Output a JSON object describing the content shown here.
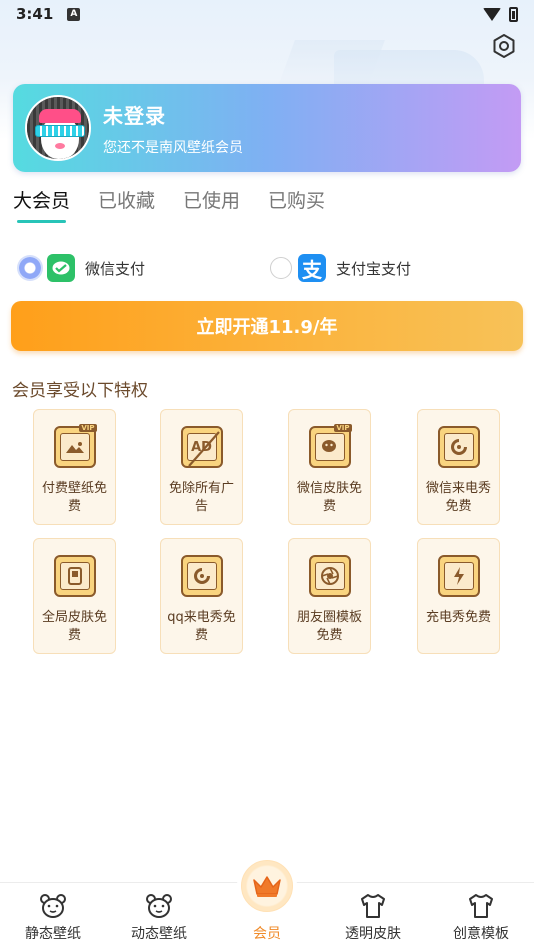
{
  "status_bar": {
    "time": "3:41",
    "notif_icon": "A"
  },
  "user": {
    "name": "未登录",
    "subtitle": "您还不是南风壁纸会员"
  },
  "tabs": [
    {
      "label": "大会员",
      "active": true
    },
    {
      "label": "已收藏",
      "active": false
    },
    {
      "label": "已使用",
      "active": false
    },
    {
      "label": "已购买",
      "active": false
    }
  ],
  "payment": {
    "options": [
      {
        "label": "微信支付",
        "icon": "wechat-pay-icon",
        "selected": true
      },
      {
        "label": "支付宝支付",
        "icon": "alipay-icon",
        "selected": false
      }
    ]
  },
  "open_button": {
    "label": "立即开通11.9/年"
  },
  "perks": {
    "title": "会员享受以下特权",
    "items": [
      {
        "label": "付费壁纸免费",
        "icon": "paid-wallpaper-icon"
      },
      {
        "label": "免除所有广告",
        "icon": "no-ads-icon"
      },
      {
        "label": "微信皮肤免费",
        "icon": "wechat-skin-icon"
      },
      {
        "label": "微信来电秀免费",
        "icon": "wechat-call-show-icon"
      },
      {
        "label": "全局皮肤免费",
        "icon": "global-skin-icon"
      },
      {
        "label": "qq来电秀免费",
        "icon": "qq-call-show-icon"
      },
      {
        "label": "朋友圈模板免费",
        "icon": "moments-template-icon"
      },
      {
        "label": "充电秀免费",
        "icon": "charging-show-icon"
      }
    ]
  },
  "bottom_nav": [
    {
      "label": "静态壁纸",
      "icon": "bear-icon"
    },
    {
      "label": "动态壁纸",
      "icon": "bear-icon"
    },
    {
      "label": "会员",
      "icon": "crown-icon",
      "active": true
    },
    {
      "label": "透明皮肤",
      "icon": "shirt-icon"
    },
    {
      "label": "创意模板",
      "icon": "shirt-icon"
    }
  ],
  "colors": {
    "accent_orange": "#ff9f1a",
    "tab_underline": "#28c4b8",
    "perk_border": "#f7dfb9",
    "active_nav": "#f08b2a"
  }
}
